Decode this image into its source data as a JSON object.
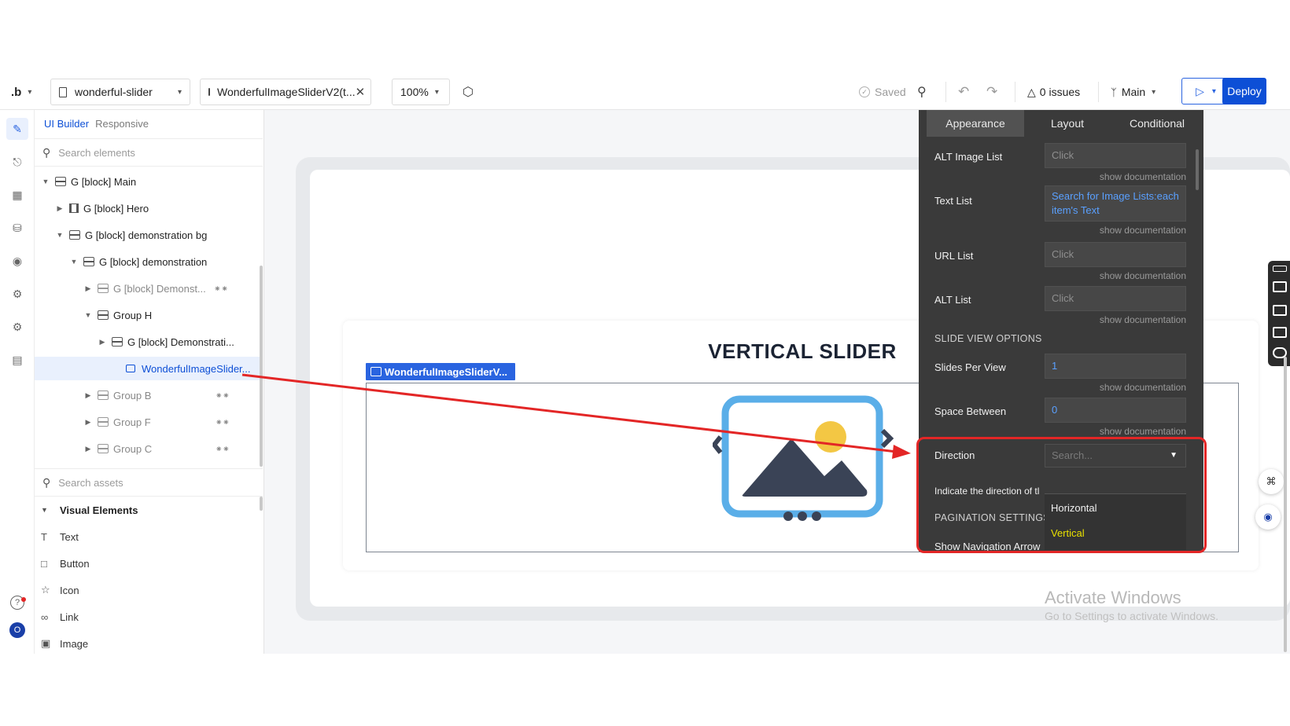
{
  "toolbar": {
    "logo": ".b",
    "app_name": "wonderful-slider",
    "page_tab": "WonderfulImageSliderV2(t...",
    "zoom": "100%",
    "saved": "Saved",
    "issues": "0 issues",
    "branch": "Main",
    "deploy": "Deploy"
  },
  "left_panel": {
    "tabs": [
      "UI Builder",
      "Responsive"
    ],
    "search_elements_placeholder": "Search elements",
    "tree": [
      {
        "label": "G [block] Main"
      },
      {
        "label": "G [block] Hero"
      },
      {
        "label": "G [block] demonstration bg"
      },
      {
        "label": "G [block] demonstration"
      },
      {
        "label": "G [block] Demonst..."
      },
      {
        "label": "Group H"
      },
      {
        "label": "G [block] Demonstrati..."
      },
      {
        "label": "WonderfulImageSlider..."
      },
      {
        "label": "Group B"
      },
      {
        "label": "Group F"
      },
      {
        "label": "Group C"
      }
    ],
    "search_assets_placeholder": "Search assets",
    "visual_elements_header": "Visual Elements",
    "visual_elements": [
      "Text",
      "Button",
      "Icon",
      "Link",
      "Image"
    ]
  },
  "canvas": {
    "slider_title": "VERTICAL SLIDER",
    "element_label": "WonderfulImageSliderV..."
  },
  "property_panel": {
    "tabs": [
      "Appearance",
      "Layout",
      "Conditional"
    ],
    "alt_image_list_label": "ALT Image List",
    "alt_image_list_value": "Click",
    "text_list_label": "Text List",
    "text_list_value": "Search for Image Lists:each item's Text",
    "url_list_label": "URL List",
    "url_list_value": "Click",
    "alt_list_label": "ALT List",
    "alt_list_value": "Click",
    "show_documentation": "show documentation",
    "slide_view_options": "SLIDE VIEW OPTIONS",
    "slides_per_view_label": "Slides Per View",
    "slides_per_view_value": "1",
    "space_between_label": "Space Between",
    "space_between_value": "0",
    "direction_label": "Direction",
    "direction_placeholder": "Search...",
    "direction_hint": "Indicate the direction of tl",
    "pagination_settings": "PAGINATION SETTINGS",
    "show_navigation_arrows": "Show Navigation Arrow",
    "direction_options": [
      "Horizontal",
      "Vertical"
    ],
    "highlight_color": "#e32626",
    "vertical_option_color": "#e8e000"
  },
  "watermark": {
    "line1": "Activate Windows",
    "line2": "Go to Settings to activate Windows."
  }
}
